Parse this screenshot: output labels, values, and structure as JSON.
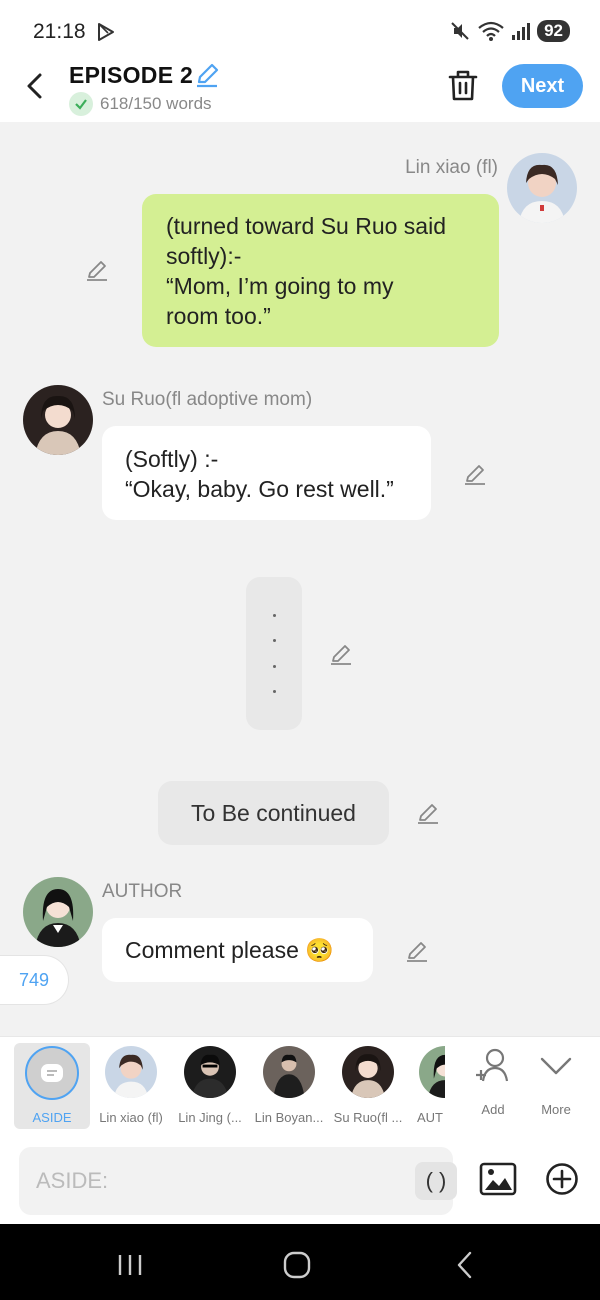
{
  "status": {
    "time": "21:18",
    "battery": "92"
  },
  "header": {
    "title": "EPISODE 2",
    "word_count": "618/150 words",
    "next_label": "Next"
  },
  "messages": [
    {
      "speaker": "Lin xiao (fl)",
      "text_lines": [
        "(turned toward Su Ruo said",
        "softly):-",
        "“Mom, I’m going to my",
        "room too.”"
      ]
    },
    {
      "speaker": "Su Ruo(fl adoptive mom)",
      "text_lines": [
        "(Softly) :-",
        "“Okay, baby. Go rest well.”"
      ]
    },
    {
      "dots": [
        ".",
        ".",
        ".",
        "."
      ]
    },
    {
      "text": "To Be continued"
    },
    {
      "speaker": "AUTHOR",
      "text": "Comment please 🥺"
    }
  ],
  "counter": "749",
  "characters": [
    {
      "label": "ASIDE",
      "selected": true
    },
    {
      "label": "Lin xiao (fl)"
    },
    {
      "label": "Lin Jing (..."
    },
    {
      "label": "Lin Boyan..."
    },
    {
      "label": "Su Ruo(fl ..."
    },
    {
      "label": "AUT"
    }
  ],
  "tools": {
    "add_label": "Add",
    "more_label": "More"
  },
  "input": {
    "placeholder": "ASIDE:",
    "paren_label": "( )"
  },
  "colors": {
    "accent": "#4fa3f2",
    "green_bubble": "#d4ef93",
    "background": "#f2f2f2"
  }
}
